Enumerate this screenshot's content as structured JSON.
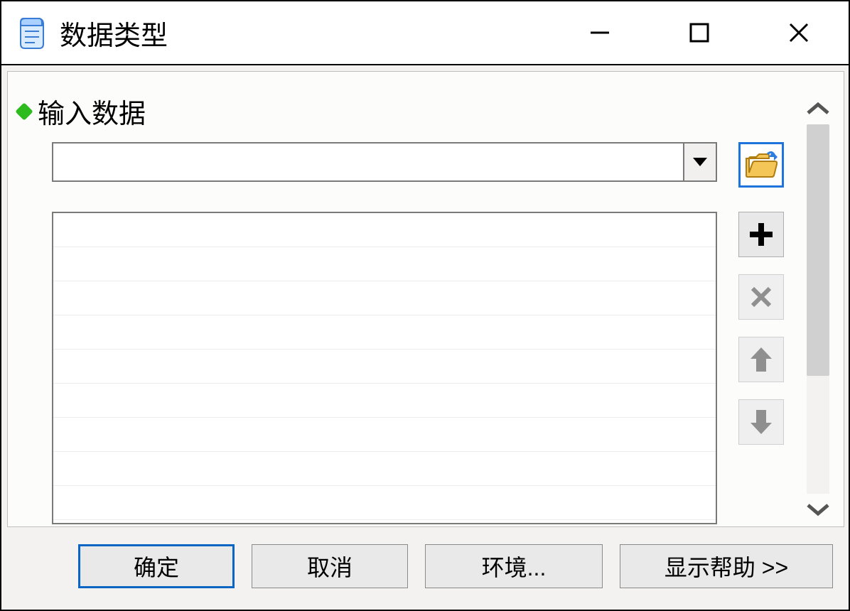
{
  "window": {
    "title": "数据类型"
  },
  "section": {
    "title": "输入数据"
  },
  "buttons": {
    "ok": "确定",
    "cancel": "取消",
    "env": "环境...",
    "help": "显示帮助 >>"
  },
  "icons": {
    "app": "scroll-icon",
    "browse": "folder-open-icon",
    "add": "plus-icon",
    "remove": "x-icon",
    "up": "arrow-up-icon",
    "down": "arrow-down-icon"
  }
}
